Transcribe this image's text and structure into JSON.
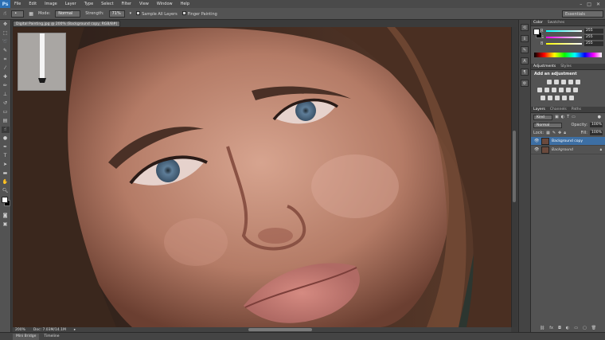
{
  "app": {
    "logo": "Ps"
  },
  "menu": [
    "File",
    "Edit",
    "Image",
    "Layer",
    "Type",
    "Select",
    "Filter",
    "View",
    "Window",
    "Help"
  ],
  "window_controls": [
    "–",
    "□",
    "✕"
  ],
  "options": {
    "mode_label": "Mode:",
    "mode_value": "Normal",
    "strength_label": "Strength:",
    "strength_value": "71%",
    "sample_all_layers": "Sample All Layers",
    "finger_painting": "Finger Painting",
    "workspace": "Essentials"
  },
  "document": {
    "tab_title": "Digital Painting.jpg @ 200% (Background copy, RGB/8#) *",
    "zoom": "200%",
    "doc_info": "Doc: 7.03M/14.1M"
  },
  "bottom_tabs": [
    "Mini Bridge",
    "Timeline"
  ],
  "color_panel": {
    "tabs": [
      "Color",
      "Swatches"
    ],
    "channels": [
      {
        "label": "R",
        "value": "255"
      },
      {
        "label": "G",
        "value": "255"
      },
      {
        "label": "B",
        "value": "255"
      }
    ]
  },
  "adjustments_panel": {
    "tabs": [
      "Adjustments",
      "Styles"
    ],
    "heading": "Add an adjustment"
  },
  "layers_panel": {
    "tabs": [
      "Layers",
      "Channels",
      "Paths"
    ],
    "kind": "Kind",
    "blend_mode": "Normal",
    "opacity_label": "Opacity:",
    "opacity_value": "100%",
    "lock_label": "Lock:",
    "fill_label": "Fill:",
    "fill_value": "100%",
    "layers": [
      {
        "name": "Background copy",
        "selected": true
      },
      {
        "name": "Background",
        "selected": false
      }
    ]
  },
  "colors": {
    "accent": "#3d6fa4",
    "ps_blue": "#2c6fb3"
  }
}
